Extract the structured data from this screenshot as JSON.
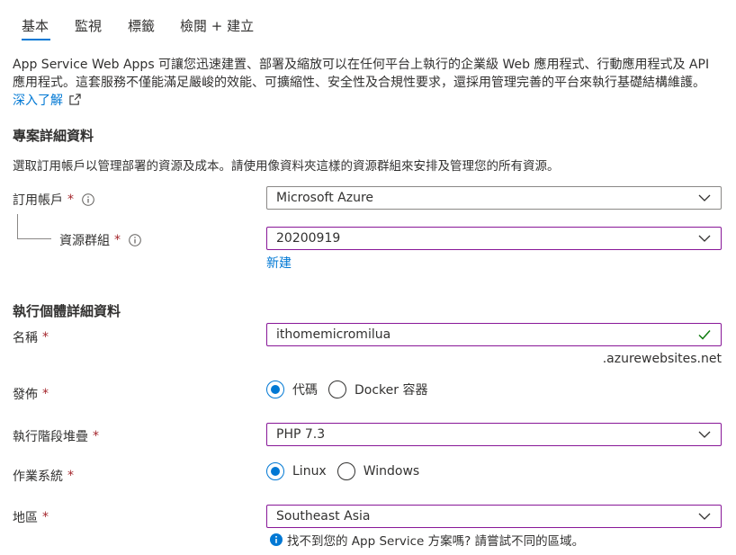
{
  "tabs": [
    {
      "label": "基本",
      "active": true
    },
    {
      "label": "監視",
      "active": false
    },
    {
      "label": "標籤",
      "active": false
    },
    {
      "label": "檢閱 + 建立",
      "active": false
    }
  ],
  "intro": {
    "text": "App Service Web Apps 可讓您迅速建置、部署及縮放可以在任何平台上執行的企業級 Web 應用程式、行動應用程式及 API 應用程式。這套服務不僅能滿足嚴峻的效能、可擴縮性、安全性及合規性要求，還採用管理完善的平台來執行基礎結構維護。",
    "learn_more": "深入了解"
  },
  "project": {
    "title": "專案詳細資料",
    "description": "選取訂用帳戶以管理部署的資源及成本。請使用像資料夾這樣的資源群組來安排及管理您的所有資源。",
    "subscription_label": "訂用帳戶",
    "subscription_value": "Microsoft Azure",
    "resource_group_label": "資源群組",
    "resource_group_value": "20200919",
    "create_new": "新建"
  },
  "instance": {
    "title": "執行個體詳細資料",
    "name_label": "名稱",
    "name_value": "ithomemicromilua",
    "name_suffix": ".azurewebsites.net",
    "publish_label": "發佈",
    "publish_options": [
      "代碼",
      "Docker 容器"
    ],
    "publish_selected": "代碼",
    "runtime_label": "執行階段堆疊",
    "runtime_value": "PHP 7.3",
    "os_label": "作業系統",
    "os_options": [
      "Linux",
      "Windows"
    ],
    "os_selected": "Linux",
    "region_label": "地區",
    "region_value": "Southeast Asia",
    "region_hint": "找不到您的 App Service 方案嗎? 請嘗試不同的區域。"
  },
  "required_mark": "*",
  "colors": {
    "accent": "#0078d4",
    "required": "#a4262c",
    "focus_border": "#881798",
    "valid": "#107c10"
  }
}
